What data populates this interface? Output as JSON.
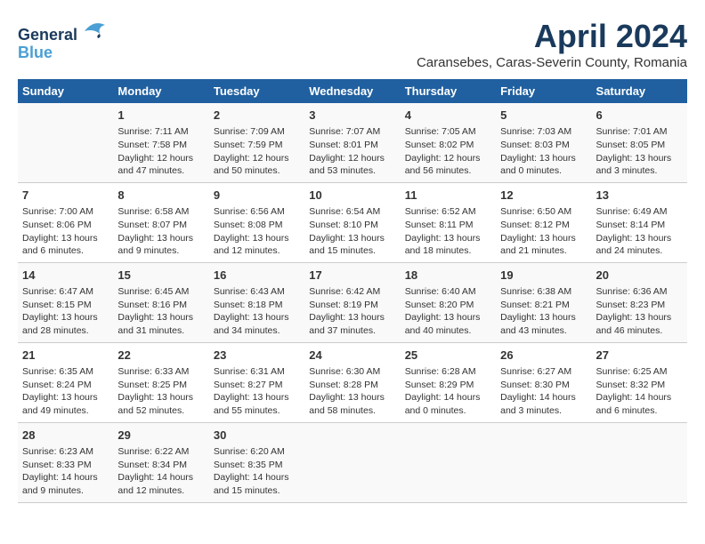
{
  "header": {
    "logo_line1": "General",
    "logo_line2": "Blue",
    "main_title": "April 2024",
    "subtitle": "Caransebes, Caras-Severin County, Romania"
  },
  "days_of_week": [
    "Sunday",
    "Monday",
    "Tuesday",
    "Wednesday",
    "Thursday",
    "Friday",
    "Saturday"
  ],
  "weeks": [
    [
      {
        "day": "",
        "info": ""
      },
      {
        "day": "1",
        "info": "Sunrise: 7:11 AM\nSunset: 7:58 PM\nDaylight: 12 hours\nand 47 minutes."
      },
      {
        "day": "2",
        "info": "Sunrise: 7:09 AM\nSunset: 7:59 PM\nDaylight: 12 hours\nand 50 minutes."
      },
      {
        "day": "3",
        "info": "Sunrise: 7:07 AM\nSunset: 8:01 PM\nDaylight: 12 hours\nand 53 minutes."
      },
      {
        "day": "4",
        "info": "Sunrise: 7:05 AM\nSunset: 8:02 PM\nDaylight: 12 hours\nand 56 minutes."
      },
      {
        "day": "5",
        "info": "Sunrise: 7:03 AM\nSunset: 8:03 PM\nDaylight: 13 hours\nand 0 minutes."
      },
      {
        "day": "6",
        "info": "Sunrise: 7:01 AM\nSunset: 8:05 PM\nDaylight: 13 hours\nand 3 minutes."
      }
    ],
    [
      {
        "day": "7",
        "info": "Sunrise: 7:00 AM\nSunset: 8:06 PM\nDaylight: 13 hours\nand 6 minutes."
      },
      {
        "day": "8",
        "info": "Sunrise: 6:58 AM\nSunset: 8:07 PM\nDaylight: 13 hours\nand 9 minutes."
      },
      {
        "day": "9",
        "info": "Sunrise: 6:56 AM\nSunset: 8:08 PM\nDaylight: 13 hours\nand 12 minutes."
      },
      {
        "day": "10",
        "info": "Sunrise: 6:54 AM\nSunset: 8:10 PM\nDaylight: 13 hours\nand 15 minutes."
      },
      {
        "day": "11",
        "info": "Sunrise: 6:52 AM\nSunset: 8:11 PM\nDaylight: 13 hours\nand 18 minutes."
      },
      {
        "day": "12",
        "info": "Sunrise: 6:50 AM\nSunset: 8:12 PM\nDaylight: 13 hours\nand 21 minutes."
      },
      {
        "day": "13",
        "info": "Sunrise: 6:49 AM\nSunset: 8:14 PM\nDaylight: 13 hours\nand 24 minutes."
      }
    ],
    [
      {
        "day": "14",
        "info": "Sunrise: 6:47 AM\nSunset: 8:15 PM\nDaylight: 13 hours\nand 28 minutes."
      },
      {
        "day": "15",
        "info": "Sunrise: 6:45 AM\nSunset: 8:16 PM\nDaylight: 13 hours\nand 31 minutes."
      },
      {
        "day": "16",
        "info": "Sunrise: 6:43 AM\nSunset: 8:18 PM\nDaylight: 13 hours\nand 34 minutes."
      },
      {
        "day": "17",
        "info": "Sunrise: 6:42 AM\nSunset: 8:19 PM\nDaylight: 13 hours\nand 37 minutes."
      },
      {
        "day": "18",
        "info": "Sunrise: 6:40 AM\nSunset: 8:20 PM\nDaylight: 13 hours\nand 40 minutes."
      },
      {
        "day": "19",
        "info": "Sunrise: 6:38 AM\nSunset: 8:21 PM\nDaylight: 13 hours\nand 43 minutes."
      },
      {
        "day": "20",
        "info": "Sunrise: 6:36 AM\nSunset: 8:23 PM\nDaylight: 13 hours\nand 46 minutes."
      }
    ],
    [
      {
        "day": "21",
        "info": "Sunrise: 6:35 AM\nSunset: 8:24 PM\nDaylight: 13 hours\nand 49 minutes."
      },
      {
        "day": "22",
        "info": "Sunrise: 6:33 AM\nSunset: 8:25 PM\nDaylight: 13 hours\nand 52 minutes."
      },
      {
        "day": "23",
        "info": "Sunrise: 6:31 AM\nSunset: 8:27 PM\nDaylight: 13 hours\nand 55 minutes."
      },
      {
        "day": "24",
        "info": "Sunrise: 6:30 AM\nSunset: 8:28 PM\nDaylight: 13 hours\nand 58 minutes."
      },
      {
        "day": "25",
        "info": "Sunrise: 6:28 AM\nSunset: 8:29 PM\nDaylight: 14 hours\nand 0 minutes."
      },
      {
        "day": "26",
        "info": "Sunrise: 6:27 AM\nSunset: 8:30 PM\nDaylight: 14 hours\nand 3 minutes."
      },
      {
        "day": "27",
        "info": "Sunrise: 6:25 AM\nSunset: 8:32 PM\nDaylight: 14 hours\nand 6 minutes."
      }
    ],
    [
      {
        "day": "28",
        "info": "Sunrise: 6:23 AM\nSunset: 8:33 PM\nDaylight: 14 hours\nand 9 minutes."
      },
      {
        "day": "29",
        "info": "Sunrise: 6:22 AM\nSunset: 8:34 PM\nDaylight: 14 hours\nand 12 minutes."
      },
      {
        "day": "30",
        "info": "Sunrise: 6:20 AM\nSunset: 8:35 PM\nDaylight: 14 hours\nand 15 minutes."
      },
      {
        "day": "",
        "info": ""
      },
      {
        "day": "",
        "info": ""
      },
      {
        "day": "",
        "info": ""
      },
      {
        "day": "",
        "info": ""
      }
    ]
  ]
}
